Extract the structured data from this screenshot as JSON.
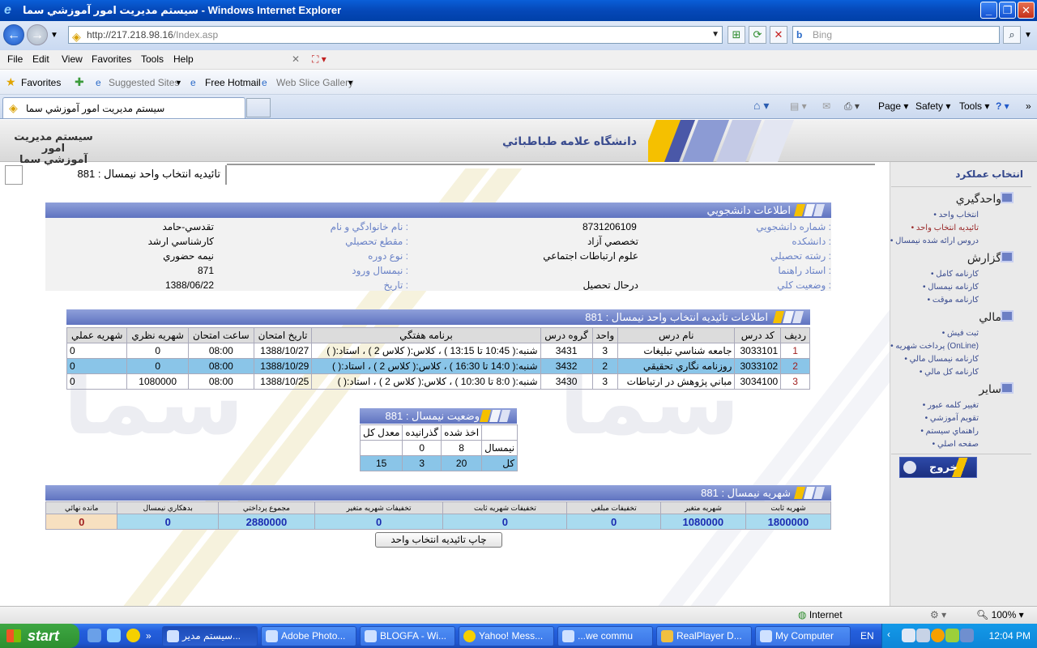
{
  "window": {
    "title": "سيستم مديريت امور آموزشي سما - Windows Internet Explorer"
  },
  "address": {
    "host": "http://217.218.98.16",
    "path": "/Index.asp",
    "search_placeholder": "Bing"
  },
  "menu": [
    "File",
    "Edit",
    "View",
    "Favorites",
    "Tools",
    "Help"
  ],
  "favorites_bar": {
    "favorites": "Favorites",
    "suggested": "Suggested Sites",
    "hotmail": "Free Hotmail",
    "webslice": "Web Slice Gallery"
  },
  "tab": {
    "title": "سيستم مديريت امور آموزشي سما"
  },
  "commands": {
    "page": "Page",
    "safety": "Safety",
    "tools": "Tools"
  },
  "header": {
    "logo_line1": "سيستم مديريت امور",
    "logo_line2": "آموزشي سما",
    "university": "دانشگاه علامه طباطبائي"
  },
  "breadcrumb": "تائيديه انتخاب واحد نيمسال : 881",
  "sidebar": {
    "title": "انتخاب عملکرد",
    "sections": [
      {
        "label": "واحدگيري",
        "items": [
          "انتخاب واحد",
          "تائيديه انتخاب واحد",
          "دروس ارائه شده نيمسال"
        ]
      },
      {
        "label": "گزارش",
        "items": [
          "کارنامه کامل",
          "کارنامه نيمسال",
          "کارنامه موقت"
        ]
      },
      {
        "label": "مالي",
        "items": [
          "ثبت فيش",
          "پرداخت شهريه (OnLine)",
          "کارنامه نيمسال مالي",
          "کارنامه کل مالي"
        ]
      },
      {
        "label": "ساير",
        "items": [
          "تغيير کلمه عبور",
          "تقويم آموزشي",
          "راهنماي سيستم",
          "صفحه اصلي"
        ]
      }
    ],
    "exit": "خروج"
  },
  "student": {
    "title": "اطلاعات دانشجويي",
    "student_no_label": "شماره دانشجويي :",
    "student_no": "8731206109",
    "faculty_label": "دانشکده :",
    "faculty": "تخصصي آزاد",
    "major_label": "رشته تحصيلي :",
    "major": "علوم ارتباطات اجتماعي",
    "advisor_label": "استاد راهنما :",
    "advisor": "",
    "status_label": "وضعيت کلي :",
    "status": "درحال تحصيل",
    "name_label": "نام خانوادگي و نام :",
    "name": "تقدسي-حامد",
    "level_label": "مقطع تحصيلي :",
    "level": "کارشناسي ارشد",
    "course_type_label": "نوع دوره :",
    "course_type": "نيمه حضوري",
    "entry_label": "نيمسال ورود :",
    "entry": "871",
    "date_label": "تاريخ :",
    "date": "1388/06/22"
  },
  "courses": {
    "title": "اطلاعات تائيديه انتخاب واحد نيمسال : 881",
    "headers": [
      "رديف",
      "کد درس",
      "نام درس",
      "واحد",
      "گروه درس",
      "برنامه هفتگي",
      "تاريخ امتحان",
      "ساعت امتحان",
      "شهريه نظري",
      "شهريه عملي"
    ],
    "rows": [
      [
        "1",
        "3033101",
        "جامعه شناسي تبليغات",
        "3",
        "3431",
        "شنبه:( 10:45 تا 13:15 ) ، کلاس:( کلاس 2 ) ، استاد:( )",
        "1388/10/27",
        "08:00",
        "0",
        "0"
      ],
      [
        "2",
        "3033102",
        "روزنامه نگاري تحقيقي",
        "2",
        "3432",
        "شنبه:( 14:0 تا 16:30 ) ، کلاس:( کلاس 2 ) ، استاد:( )",
        "1388/10/29",
        "08:00",
        "0",
        "0"
      ],
      [
        "3",
        "3034100",
        "مباني پژوهش در ارتباطات",
        "3",
        "3430",
        "شنبه:( 8:0 تا 10:30 ) ، کلاس:( کلاس 2 ) ، استاد:( )",
        "1388/10/25",
        "08:00",
        "1080000",
        "0"
      ]
    ]
  },
  "semester_status": {
    "title": "وضعيت نيمسال : 881",
    "headers": [
      "",
      "اخذ شده",
      "گذرانيده",
      "معدل کل"
    ],
    "rows": [
      [
        "نيمسال",
        "8",
        "0",
        ""
      ],
      [
        "کل",
        "20",
        "3",
        "15"
      ]
    ]
  },
  "tuition": {
    "title": "شهريه نيمسال : 881",
    "headers": [
      "شهريه ثابت",
      "شهريه متغير",
      "تخفيفات مبلغي",
      "تخفيفات شهريه ثابت",
      "تخفيفات شهريه متغير",
      "مجموع پرداختي",
      "بدهکاري نيمسال",
      "مانده نهائي"
    ],
    "values": [
      "1800000",
      "1080000",
      "0",
      "0",
      "0",
      "2880000",
      "0",
      "0"
    ]
  },
  "print_button": "چاپ تائيديه انتخاب واحد",
  "statusbar": {
    "zone": "Internet",
    "zoom": "100%"
  },
  "taskbar": {
    "start": "start",
    "tasks": [
      "سيستم مدير...",
      "Adobe Photo...",
      "BLOGFA - Wi...",
      "Yahoo! Mess...",
      "...we commu",
      "RealPlayer D...",
      "My Computer"
    ],
    "lang": "EN",
    "clock": "12:04 PM"
  }
}
